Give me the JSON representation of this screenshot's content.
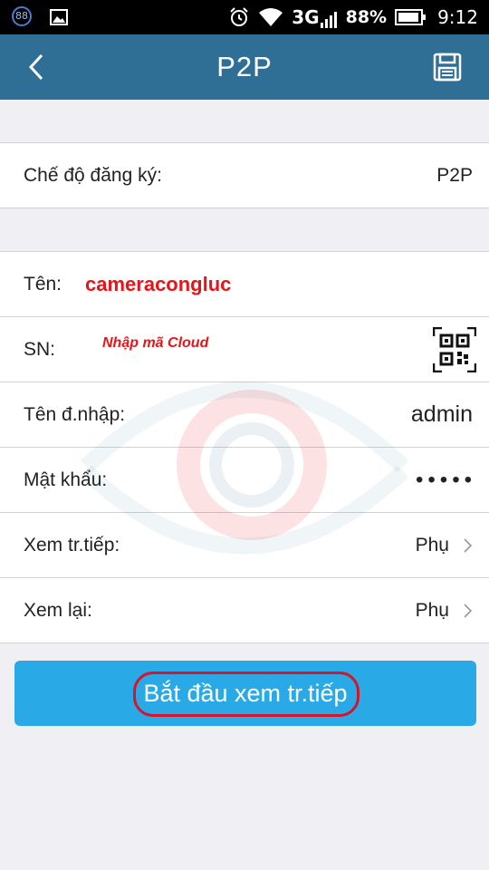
{
  "status_bar": {
    "notification_badge": "88",
    "network": "3G",
    "battery": "88%",
    "time": "9:12"
  },
  "header": {
    "title": "P2P",
    "back_icon": "chevron-left-icon",
    "save_icon": "save-icon"
  },
  "form": {
    "registration_mode": {
      "label": "Chế độ đăng ký:",
      "value": "P2P"
    },
    "name": {
      "label": "Tên:",
      "value": "cameracongluc"
    },
    "sn": {
      "label": "SN:",
      "hint": "Nhập mã Cloud",
      "scan_icon": "qr-scan-icon"
    },
    "username": {
      "label": "Tên đ.nhập:",
      "value": "admin"
    },
    "password": {
      "label": "Mật khẩu:",
      "value": "•••••"
    },
    "live_view": {
      "label": "Xem tr.tiếp:",
      "value": "Phụ"
    },
    "playback": {
      "label": "Xem lại:",
      "value": "Phụ"
    }
  },
  "start_button": {
    "label": "Bắt đầu xem tr.tiếp"
  },
  "colors": {
    "header": "#2f6f95",
    "button": "#29a9e6",
    "annotation_red": "#e8141a"
  }
}
